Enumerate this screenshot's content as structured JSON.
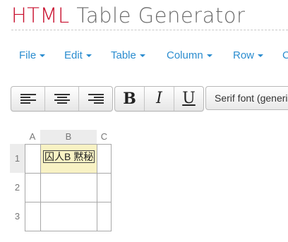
{
  "header": {
    "logo_html": "HTML",
    "logo_rest": " Table Generator"
  },
  "menu": {
    "items": [
      {
        "label": "File"
      },
      {
        "label": "Edit"
      },
      {
        "label": "Table"
      },
      {
        "label": "Column"
      },
      {
        "label": "Row"
      },
      {
        "label": "C"
      }
    ]
  },
  "toolbar": {
    "align_left_icon": "align-left-icon",
    "align_center_icon": "align-center-icon",
    "align_right_icon": "align-right-icon",
    "bold_label": "B",
    "italic_label": "I",
    "underline_label": "U",
    "font_select_value": "Serif font (generic)"
  },
  "grid": {
    "columns": [
      "A",
      "B",
      "C"
    ],
    "rows": [
      "1",
      "2",
      "3"
    ],
    "cells": [
      [
        "",
        "囚人B 黙秘",
        ""
      ],
      [
        "",
        "",
        ""
      ],
      [
        "",
        "",
        ""
      ]
    ],
    "selected_row": "1",
    "selected_column": "B"
  },
  "colors": {
    "logo_accent": "#c8102e",
    "link": "#2a8ccf",
    "active_cell": "#f8f2c4"
  }
}
